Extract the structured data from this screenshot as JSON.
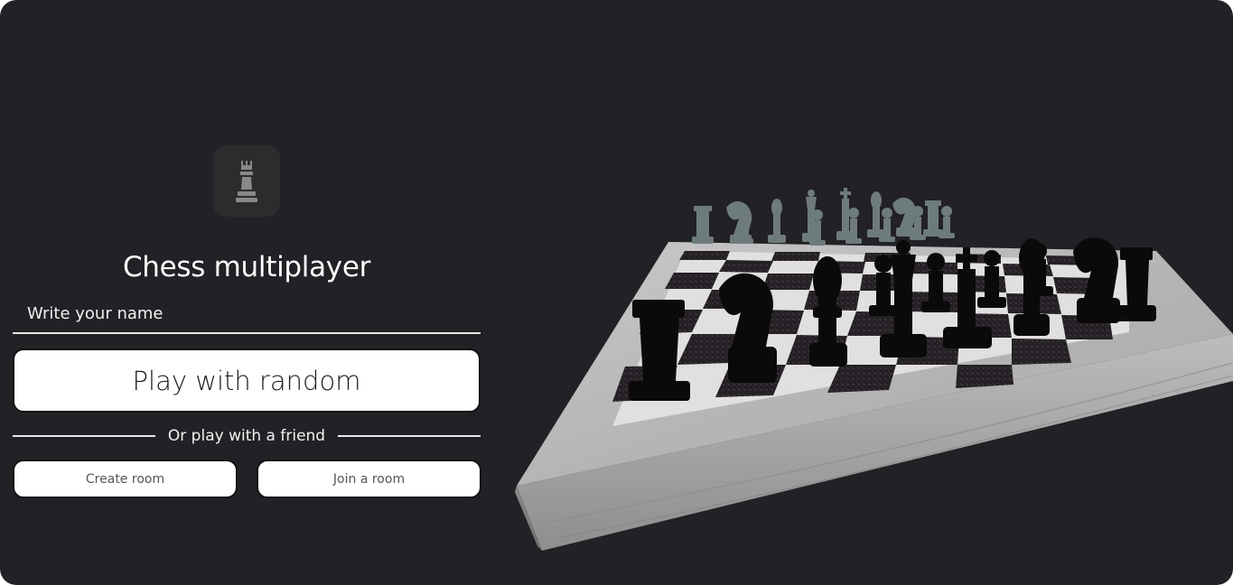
{
  "app": {
    "title": "Chess multiplayer",
    "logo_icon": "chess-rook-icon"
  },
  "form": {
    "name_placeholder": "Write your name",
    "name_value": "",
    "play_random_label": "Play with random",
    "divider_text": "Or play with a friend",
    "create_room_label": "Create room",
    "join_room_label": "Join a room"
  },
  "colors": {
    "background": "#222125",
    "logo_tile": "#2c2c2f",
    "button_bg": "#ffffff",
    "white_pieces": "#6e7b7c",
    "black_pieces": "#0a0a0a"
  }
}
